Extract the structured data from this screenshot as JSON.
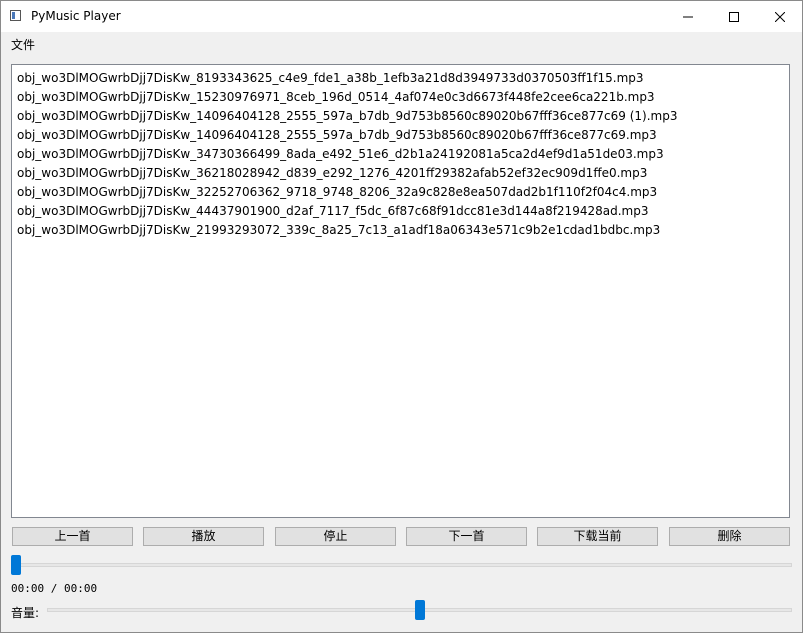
{
  "window": {
    "title": "PyMusic Player",
    "icon": "app-window-icon"
  },
  "menubar": {
    "items": [
      {
        "label": "文件"
      }
    ]
  },
  "playlist": {
    "items": [
      "obj_wo3DlMOGwrbDjj7DisKw_8193343625_c4e9_fde1_a38b_1efb3a21d8d3949733d0370503ff1f15.mp3",
      "obj_wo3DlMOGwrbDjj7DisKw_15230976971_8ceb_196d_0514_4af074e0c3d6673f448fe2cee6ca221b.mp3",
      "obj_wo3DlMOGwrbDjj7DisKw_14096404128_2555_597a_b7db_9d753b8560c89020b67fff36ce877c69 (1).mp3",
      "obj_wo3DlMOGwrbDjj7DisKw_14096404128_2555_597a_b7db_9d753b8560c89020b67fff36ce877c69.mp3",
      "obj_wo3DlMOGwrbDjj7DisKw_34730366499_8ada_e492_51e6_d2b1a24192081a5ca2d4ef9d1a51de03.mp3",
      "obj_wo3DlMOGwrbDjj7DisKw_36218028942_d839_e292_1276_4201ff29382afab52ef32ec909d1ffe0.mp3",
      "obj_wo3DlMOGwrbDjj7DisKw_32252706362_9718_9748_8206_32a9c828e8ea507dad2b1f110f2f04c4.mp3",
      "obj_wo3DlMOGwrbDjj7DisKw_44437901900_d2af_7117_f5dc_6f87c68f91dcc81e3d144a8f219428ad.mp3",
      "obj_wo3DlMOGwrbDjj7DisKw_21993293072_339c_8a25_7c13_a1adf18a06343e571c9b2e1cdad1bdbc.mp3"
    ]
  },
  "controls": {
    "prev_label": "上一首",
    "play_label": "播放",
    "stop_label": "停止",
    "next_label": "下一首",
    "download_label": "下载当前",
    "delete_label": "删除"
  },
  "progress": {
    "time_text": "00:00 / 00:00",
    "position_fraction": 0.0
  },
  "volume": {
    "label": "音量:",
    "level_fraction": 0.5
  },
  "colors": {
    "accent": "#0078d7",
    "button_bg": "#e1e1e1",
    "list_bg": "#ffffff"
  }
}
